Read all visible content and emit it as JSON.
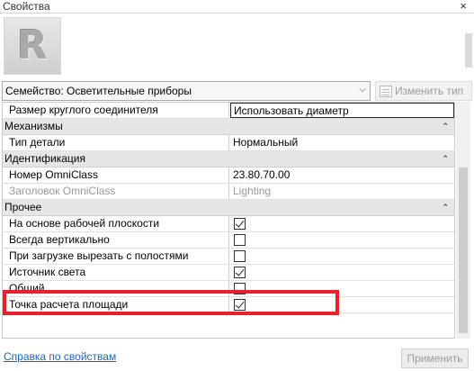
{
  "window": {
    "title": "Свойства",
    "close_glyph": "×"
  },
  "preview": {
    "logo_letter": "R"
  },
  "type_selector": {
    "value": "Семейство: Осветительные приборы",
    "chevron": "⌵"
  },
  "edit_type": {
    "label": "Изменить тип"
  },
  "properties": {
    "row_connector": {
      "name": "Размер круглого соединителя",
      "value": "Использовать диаметр"
    },
    "group_mech": {
      "label": "Механизмы",
      "toggle": "⌃"
    },
    "row_detail_type": {
      "name": "Тип детали",
      "value": "Нормальный"
    },
    "group_ident": {
      "label": "Идентификация",
      "toggle": "⌃"
    },
    "row_omniclass_num": {
      "name": "Номер OmniClass",
      "value": "23.80.70.00"
    },
    "row_omniclass_title": {
      "name": "Заголовок OmniClass",
      "value": "Lighting"
    },
    "group_other": {
      "label": "Прочее",
      "toggle": "⌃"
    },
    "row_work_plane": {
      "name": "На основе рабочей плоскости",
      "checked": true
    },
    "row_always_vertical": {
      "name": "Всегда вертикально",
      "checked": false
    },
    "row_cut_voids": {
      "name": "При загрузке вырезать с полостями",
      "checked": false
    },
    "row_light_source": {
      "name": "Источник света",
      "checked": true
    },
    "row_shared": {
      "name": "Общий",
      "checked": false
    },
    "row_room_calc": {
      "name": "Точка расчета площади",
      "checked": true
    }
  },
  "footer": {
    "help_link": "Справка по свойствам",
    "apply_label": "Применить"
  },
  "colors": {
    "highlight": "#e8202a",
    "link": "#1d66b5",
    "group_bg": "#e6e6e6"
  }
}
